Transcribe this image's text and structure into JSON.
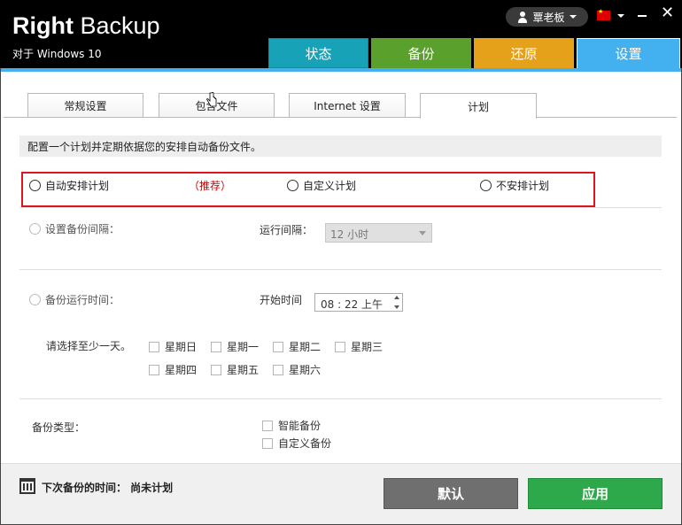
{
  "app": {
    "title_bold": "Right",
    "title_rest": " Backup",
    "subtitle": "对于 Windows 10"
  },
  "header": {
    "user_name": "覃老板"
  },
  "main_tabs": [
    {
      "label": "状态"
    },
    {
      "label": "备份"
    },
    {
      "label": "还原"
    },
    {
      "label": "设置"
    }
  ],
  "sub_tabs": [
    {
      "label": "常规设置"
    },
    {
      "label": "包含文件"
    },
    {
      "label": "Internet 设置"
    },
    {
      "label": "计划"
    }
  ],
  "info_text": "配置一个计划并定期依据您的安排自动备份文件。",
  "schedule_options": {
    "auto": "自动安排计划",
    "recommended": "（推荐）",
    "custom": "自定义计划",
    "none": "不安排计划"
  },
  "interval": {
    "radio_label": "设置备份间隔：",
    "run_label": "运行间隔：",
    "value": "12 小时"
  },
  "run_time": {
    "radio_label": "备份运行时间：",
    "start_label": "开始时间",
    "value": "08 : 22 上午"
  },
  "days": {
    "prompt": "请选择至少一天。",
    "items": [
      "星期日",
      "星期一",
      "星期二",
      "星期三",
      "星期四",
      "星期五",
      "星期六"
    ]
  },
  "backup_type": {
    "label": "备份类型：",
    "smart": "智能备份",
    "custom": "自定义备份"
  },
  "footer": {
    "next_label": "下次备份的时间：  尚未计划",
    "default_btn": "默认",
    "apply_btn": "应用"
  },
  "colors": {
    "status_tab": "#17a2b8",
    "backup_tab": "#5aa02c",
    "restore_tab": "#e6a11a",
    "settings_tab": "#43b0f0",
    "apply_btn": "#2da84a",
    "highlight_border": "#e0141e"
  }
}
